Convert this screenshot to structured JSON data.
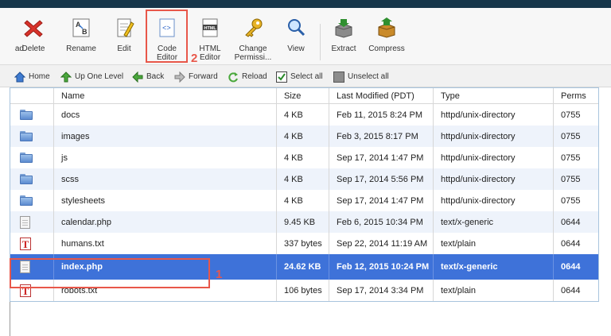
{
  "toolbar": {
    "items": [
      {
        "label": "ad",
        "icon": "download-icon"
      },
      {
        "label": "Delete",
        "icon": "delete-icon"
      },
      {
        "label": "Rename",
        "icon": "rename-icon"
      },
      {
        "label": "Edit",
        "icon": "edit-icon"
      },
      {
        "label": "Code Editor",
        "icon": "code-editor-icon"
      },
      {
        "label": "HTML Editor",
        "icon": "html-editor-icon"
      },
      {
        "label": "Change Permissi...",
        "icon": "key-icon"
      },
      {
        "label": "View",
        "icon": "magnifier-icon"
      },
      {
        "label": "Extract",
        "icon": "extract-icon"
      },
      {
        "label": "Compress",
        "icon": "compress-icon"
      }
    ]
  },
  "nav": {
    "home": "Home",
    "up": "Up One Level",
    "back": "Back",
    "forward": "Forward",
    "reload": "Reload",
    "select_all": "Select all",
    "unselect_all": "Unselect all"
  },
  "table": {
    "headers": {
      "name": "Name",
      "size": "Size",
      "modified": "Last Modified (PDT)",
      "type": "Type",
      "perms": "Perms"
    },
    "rows": [
      {
        "name": "docs",
        "size": "4 KB",
        "modified": "Feb 11, 2015 8:24 PM",
        "type": "httpd/unix-directory",
        "perms": "0755",
        "icon": "folder-icon"
      },
      {
        "name": "images",
        "size": "4 KB",
        "modified": "Feb 3, 2015 8:17 PM",
        "type": "httpd/unix-directory",
        "perms": "0755",
        "icon": "folder-icon"
      },
      {
        "name": "js",
        "size": "4 KB",
        "modified": "Sep 17, 2014 1:47 PM",
        "type": "httpd/unix-directory",
        "perms": "0755",
        "icon": "folder-icon"
      },
      {
        "name": "scss",
        "size": "4 KB",
        "modified": "Sep 17, 2014 5:56 PM",
        "type": "httpd/unix-directory",
        "perms": "0755",
        "icon": "folder-icon"
      },
      {
        "name": "stylesheets",
        "size": "4 KB",
        "modified": "Sep 17, 2014 1:47 PM",
        "type": "httpd/unix-directory",
        "perms": "0755",
        "icon": "folder-icon"
      },
      {
        "name": "calendar.php",
        "size": "9.45 KB",
        "modified": "Feb 6, 2015 10:34 PM",
        "type": "text/x-generic",
        "perms": "0644",
        "icon": "generic-file-icon"
      },
      {
        "name": "humans.txt",
        "size": "337 bytes",
        "modified": "Sep 22, 2014 11:19 AM",
        "type": "text/plain",
        "perms": "0644",
        "icon": "text-file-icon"
      },
      {
        "name": "index.php",
        "size": "24.62 KB",
        "modified": "Feb 12, 2015 10:24 PM",
        "type": "text/x-generic",
        "perms": "0644",
        "icon": "generic-file-icon",
        "selected": true
      },
      {
        "name": "robots.txt",
        "size": "106 bytes",
        "modified": "Sep 17, 2014 3:34 PM",
        "type": "text/plain",
        "perms": "0644",
        "icon": "text-file-icon"
      }
    ]
  },
  "annotations": {
    "marker_1": "1",
    "marker_2": "2",
    "color": "#e8574a"
  },
  "colors": {
    "selected_row": "#3e72d9",
    "header_bar": "#16364a"
  }
}
